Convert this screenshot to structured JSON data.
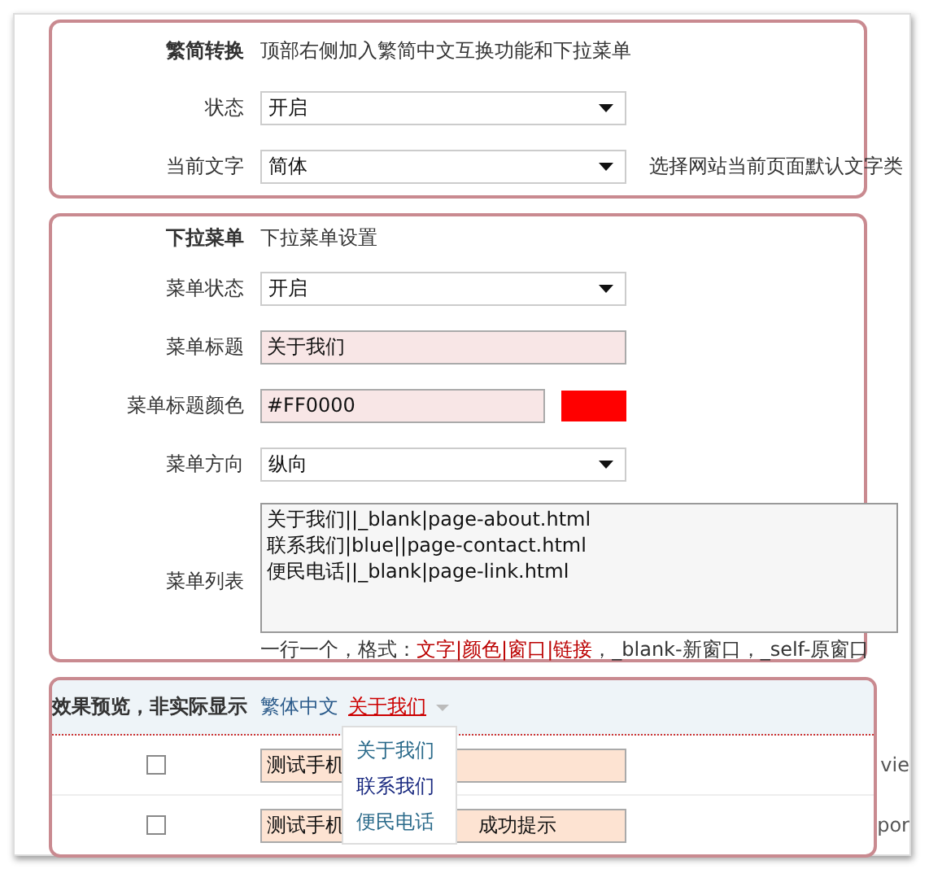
{
  "sections": [
    {
      "title": "繁简转换",
      "description": "顶部右侧加入繁简中文互换功能和下拉菜单",
      "fields": [
        {
          "kind": "select",
          "label": "状态",
          "value": "开启"
        },
        {
          "kind": "select",
          "label": "当前文字",
          "value": "简体",
          "note": "选择网站当前页面默认文字类"
        }
      ]
    },
    {
      "title": "下拉菜单",
      "description": "下拉菜单设置",
      "fields": [
        {
          "kind": "select",
          "label": "菜单状态",
          "value": "开启"
        },
        {
          "kind": "text",
          "label": "菜单标题",
          "value": "关于我们"
        },
        {
          "kind": "color",
          "label": "菜单标题颜色",
          "value": "#FF0000"
        },
        {
          "kind": "select",
          "label": "菜单方向",
          "value": "纵向"
        },
        {
          "kind": "textarea",
          "label": "菜单列表",
          "lines": [
            "关于我们||_blank|page-about.html",
            "联系我们|blue||page-contact.html",
            "便民电话||_blank|page-link.html"
          ],
          "hint": [
            {
              "text": "一行一个，格式：",
              "highlight": false
            },
            {
              "text": "文字|颜色|窗口|链接",
              "highlight": true
            },
            {
              "text": "，_blank-新窗口，_self-原窗口",
              "highlight": false
            }
          ]
        }
      ]
    }
  ],
  "preview": {
    "label": "效果预览，非实际显示",
    "switch_link": "繁体中文",
    "menu_title": "关于我们",
    "menu_items": [
      "关于我们",
      "联系我们",
      "便民电话"
    ],
    "rows": [
      {
        "checked": false,
        "parts": [
          "测试手机"
        ],
        "right": "vie"
      },
      {
        "checked": false,
        "parts": [
          "测试手机",
          "成功提示"
        ],
        "right": "por"
      }
    ]
  }
}
